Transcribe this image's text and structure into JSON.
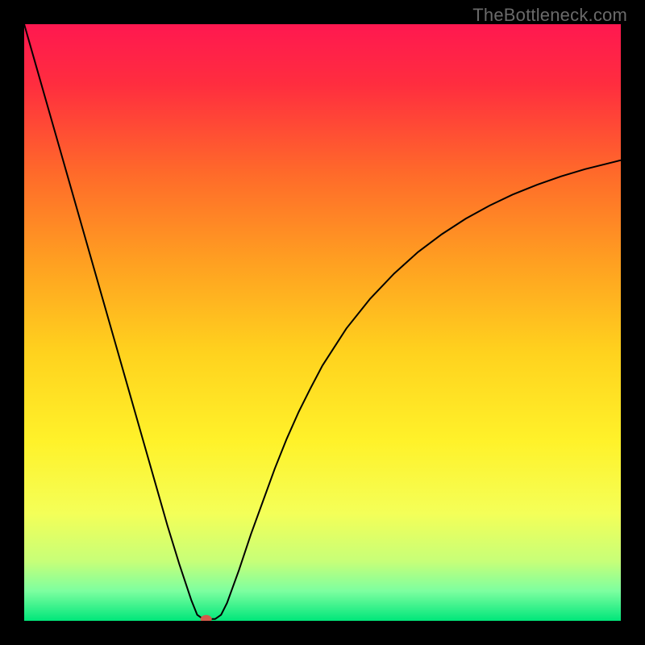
{
  "watermark": "TheBottleneck.com",
  "chart_data": {
    "type": "line",
    "title": "",
    "xlabel": "",
    "ylabel": "",
    "xlim": [
      0,
      100
    ],
    "ylim": [
      0,
      100
    ],
    "background": {
      "type": "vertical-gradient",
      "stops": [
        {
          "offset": 0.0,
          "color": "#ff1850"
        },
        {
          "offset": 0.1,
          "color": "#ff2d3f"
        },
        {
          "offset": 0.25,
          "color": "#ff6a2a"
        },
        {
          "offset": 0.4,
          "color": "#ffa021"
        },
        {
          "offset": 0.55,
          "color": "#ffd21e"
        },
        {
          "offset": 0.7,
          "color": "#fff22a"
        },
        {
          "offset": 0.82,
          "color": "#f4ff58"
        },
        {
          "offset": 0.9,
          "color": "#c7ff78"
        },
        {
          "offset": 0.95,
          "color": "#7dffa0"
        },
        {
          "offset": 1.0,
          "color": "#00e67a"
        }
      ]
    },
    "series": [
      {
        "name": "bottleneck-curve",
        "color": "#000000",
        "width": 2,
        "x": [
          0,
          2,
          4,
          6,
          8,
          10,
          12,
          14,
          16,
          18,
          20,
          22,
          24,
          26,
          28,
          29,
          30,
          31,
          32,
          33,
          34,
          36,
          38,
          40,
          42,
          44,
          46,
          48,
          50,
          54,
          58,
          62,
          66,
          70,
          74,
          78,
          82,
          86,
          90,
          94,
          98,
          100
        ],
        "y": [
          100,
          93.0,
          86.0,
          79.0,
          72.0,
          65.0,
          58.0,
          51.0,
          44.0,
          37.0,
          30.0,
          23.0,
          16.0,
          9.5,
          3.5,
          1.0,
          0.3,
          0.3,
          0.3,
          1.0,
          3.0,
          8.5,
          14.5,
          20.0,
          25.5,
          30.5,
          35.0,
          39.0,
          42.8,
          49.0,
          54.0,
          58.2,
          61.8,
          64.8,
          67.4,
          69.6,
          71.5,
          73.1,
          74.5,
          75.7,
          76.7,
          77.2
        ]
      }
    ],
    "marker": {
      "name": "optimal-point",
      "x": 30.5,
      "y": 0.3,
      "color": "#d45a4a",
      "rx": 7,
      "ry": 5
    }
  }
}
